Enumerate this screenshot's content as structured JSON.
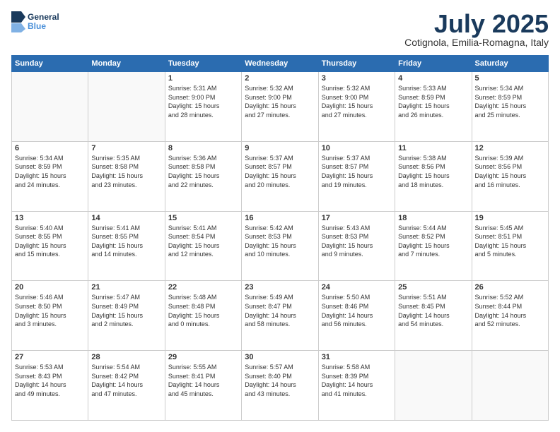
{
  "logo": {
    "line1": "General",
    "line2": "Blue"
  },
  "title": "July 2025",
  "subtitle": "Cotignola, Emilia-Romagna, Italy",
  "days_header": [
    "Sunday",
    "Monday",
    "Tuesday",
    "Wednesday",
    "Thursday",
    "Friday",
    "Saturday"
  ],
  "weeks": [
    [
      {
        "day": "",
        "info": ""
      },
      {
        "day": "",
        "info": ""
      },
      {
        "day": "1",
        "info": "Sunrise: 5:31 AM\nSunset: 9:00 PM\nDaylight: 15 hours\nand 28 minutes."
      },
      {
        "day": "2",
        "info": "Sunrise: 5:32 AM\nSunset: 9:00 PM\nDaylight: 15 hours\nand 27 minutes."
      },
      {
        "day": "3",
        "info": "Sunrise: 5:32 AM\nSunset: 9:00 PM\nDaylight: 15 hours\nand 27 minutes."
      },
      {
        "day": "4",
        "info": "Sunrise: 5:33 AM\nSunset: 8:59 PM\nDaylight: 15 hours\nand 26 minutes."
      },
      {
        "day": "5",
        "info": "Sunrise: 5:34 AM\nSunset: 8:59 PM\nDaylight: 15 hours\nand 25 minutes."
      }
    ],
    [
      {
        "day": "6",
        "info": "Sunrise: 5:34 AM\nSunset: 8:59 PM\nDaylight: 15 hours\nand 24 minutes."
      },
      {
        "day": "7",
        "info": "Sunrise: 5:35 AM\nSunset: 8:58 PM\nDaylight: 15 hours\nand 23 minutes."
      },
      {
        "day": "8",
        "info": "Sunrise: 5:36 AM\nSunset: 8:58 PM\nDaylight: 15 hours\nand 22 minutes."
      },
      {
        "day": "9",
        "info": "Sunrise: 5:37 AM\nSunset: 8:57 PM\nDaylight: 15 hours\nand 20 minutes."
      },
      {
        "day": "10",
        "info": "Sunrise: 5:37 AM\nSunset: 8:57 PM\nDaylight: 15 hours\nand 19 minutes."
      },
      {
        "day": "11",
        "info": "Sunrise: 5:38 AM\nSunset: 8:56 PM\nDaylight: 15 hours\nand 18 minutes."
      },
      {
        "day": "12",
        "info": "Sunrise: 5:39 AM\nSunset: 8:56 PM\nDaylight: 15 hours\nand 16 minutes."
      }
    ],
    [
      {
        "day": "13",
        "info": "Sunrise: 5:40 AM\nSunset: 8:55 PM\nDaylight: 15 hours\nand 15 minutes."
      },
      {
        "day": "14",
        "info": "Sunrise: 5:41 AM\nSunset: 8:55 PM\nDaylight: 15 hours\nand 14 minutes."
      },
      {
        "day": "15",
        "info": "Sunrise: 5:41 AM\nSunset: 8:54 PM\nDaylight: 15 hours\nand 12 minutes."
      },
      {
        "day": "16",
        "info": "Sunrise: 5:42 AM\nSunset: 8:53 PM\nDaylight: 15 hours\nand 10 minutes."
      },
      {
        "day": "17",
        "info": "Sunrise: 5:43 AM\nSunset: 8:53 PM\nDaylight: 15 hours\nand 9 minutes."
      },
      {
        "day": "18",
        "info": "Sunrise: 5:44 AM\nSunset: 8:52 PM\nDaylight: 15 hours\nand 7 minutes."
      },
      {
        "day": "19",
        "info": "Sunrise: 5:45 AM\nSunset: 8:51 PM\nDaylight: 15 hours\nand 5 minutes."
      }
    ],
    [
      {
        "day": "20",
        "info": "Sunrise: 5:46 AM\nSunset: 8:50 PM\nDaylight: 15 hours\nand 3 minutes."
      },
      {
        "day": "21",
        "info": "Sunrise: 5:47 AM\nSunset: 8:49 PM\nDaylight: 15 hours\nand 2 minutes."
      },
      {
        "day": "22",
        "info": "Sunrise: 5:48 AM\nSunset: 8:48 PM\nDaylight: 15 hours\nand 0 minutes."
      },
      {
        "day": "23",
        "info": "Sunrise: 5:49 AM\nSunset: 8:47 PM\nDaylight: 14 hours\nand 58 minutes."
      },
      {
        "day": "24",
        "info": "Sunrise: 5:50 AM\nSunset: 8:46 PM\nDaylight: 14 hours\nand 56 minutes."
      },
      {
        "day": "25",
        "info": "Sunrise: 5:51 AM\nSunset: 8:45 PM\nDaylight: 14 hours\nand 54 minutes."
      },
      {
        "day": "26",
        "info": "Sunrise: 5:52 AM\nSunset: 8:44 PM\nDaylight: 14 hours\nand 52 minutes."
      }
    ],
    [
      {
        "day": "27",
        "info": "Sunrise: 5:53 AM\nSunset: 8:43 PM\nDaylight: 14 hours\nand 49 minutes."
      },
      {
        "day": "28",
        "info": "Sunrise: 5:54 AM\nSunset: 8:42 PM\nDaylight: 14 hours\nand 47 minutes."
      },
      {
        "day": "29",
        "info": "Sunrise: 5:55 AM\nSunset: 8:41 PM\nDaylight: 14 hours\nand 45 minutes."
      },
      {
        "day": "30",
        "info": "Sunrise: 5:57 AM\nSunset: 8:40 PM\nDaylight: 14 hours\nand 43 minutes."
      },
      {
        "day": "31",
        "info": "Sunrise: 5:58 AM\nSunset: 8:39 PM\nDaylight: 14 hours\nand 41 minutes."
      },
      {
        "day": "",
        "info": ""
      },
      {
        "day": "",
        "info": ""
      }
    ]
  ]
}
